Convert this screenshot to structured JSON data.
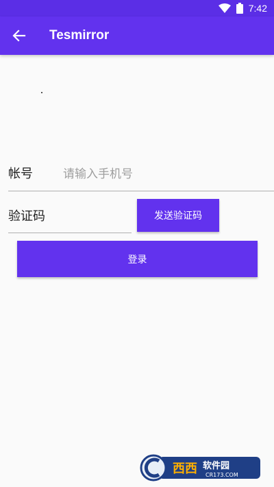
{
  "status_bar": {
    "time": "7:42",
    "wifi_icon": "wifi-icon",
    "battery_icon": "battery-icon"
  },
  "app_bar": {
    "title": "Tesmirror",
    "back_icon": "arrow-back-icon"
  },
  "form": {
    "account_label": "帐号",
    "phone_placeholder": "请输入手机号",
    "phone_value": "",
    "code_label": "验证码",
    "code_value": "",
    "send_code_label": "发送验证码",
    "login_label": "登录"
  },
  "watermark": {
    "name": "西西软件园",
    "site": "CR173.COM"
  },
  "colors": {
    "primary": "#6232ee",
    "status_bar": "#5b2ee6",
    "background": "#fafafa",
    "placeholder": "#9e9e9e"
  }
}
